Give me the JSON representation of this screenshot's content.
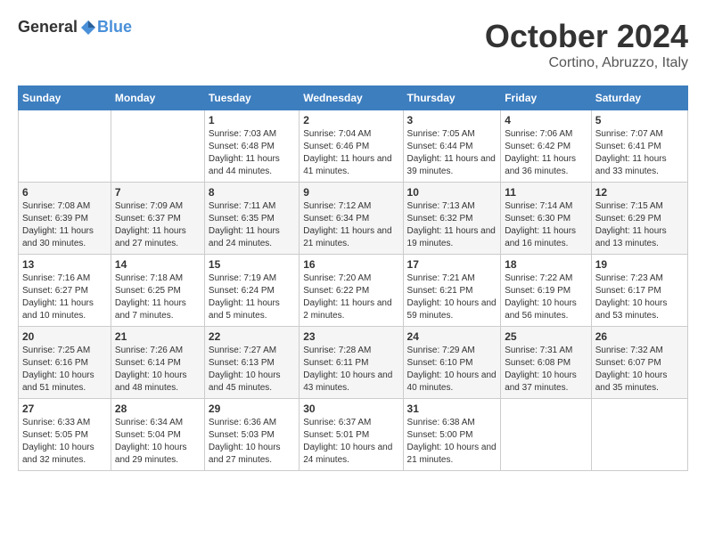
{
  "logo": {
    "general": "General",
    "blue": "Blue"
  },
  "title": "October 2024",
  "location": "Cortino, Abruzzo, Italy",
  "headers": [
    "Sunday",
    "Monday",
    "Tuesday",
    "Wednesday",
    "Thursday",
    "Friday",
    "Saturday"
  ],
  "weeks": [
    [
      {
        "day": "",
        "info": ""
      },
      {
        "day": "",
        "info": ""
      },
      {
        "day": "1",
        "info": "Sunrise: 7:03 AM\nSunset: 6:48 PM\nDaylight: 11 hours and 44 minutes."
      },
      {
        "day": "2",
        "info": "Sunrise: 7:04 AM\nSunset: 6:46 PM\nDaylight: 11 hours and 41 minutes."
      },
      {
        "day": "3",
        "info": "Sunrise: 7:05 AM\nSunset: 6:44 PM\nDaylight: 11 hours and 39 minutes."
      },
      {
        "day": "4",
        "info": "Sunrise: 7:06 AM\nSunset: 6:42 PM\nDaylight: 11 hours and 36 minutes."
      },
      {
        "day": "5",
        "info": "Sunrise: 7:07 AM\nSunset: 6:41 PM\nDaylight: 11 hours and 33 minutes."
      }
    ],
    [
      {
        "day": "6",
        "info": "Sunrise: 7:08 AM\nSunset: 6:39 PM\nDaylight: 11 hours and 30 minutes."
      },
      {
        "day": "7",
        "info": "Sunrise: 7:09 AM\nSunset: 6:37 PM\nDaylight: 11 hours and 27 minutes."
      },
      {
        "day": "8",
        "info": "Sunrise: 7:11 AM\nSunset: 6:35 PM\nDaylight: 11 hours and 24 minutes."
      },
      {
        "day": "9",
        "info": "Sunrise: 7:12 AM\nSunset: 6:34 PM\nDaylight: 11 hours and 21 minutes."
      },
      {
        "day": "10",
        "info": "Sunrise: 7:13 AM\nSunset: 6:32 PM\nDaylight: 11 hours and 19 minutes."
      },
      {
        "day": "11",
        "info": "Sunrise: 7:14 AM\nSunset: 6:30 PM\nDaylight: 11 hours and 16 minutes."
      },
      {
        "day": "12",
        "info": "Sunrise: 7:15 AM\nSunset: 6:29 PM\nDaylight: 11 hours and 13 minutes."
      }
    ],
    [
      {
        "day": "13",
        "info": "Sunrise: 7:16 AM\nSunset: 6:27 PM\nDaylight: 11 hours and 10 minutes."
      },
      {
        "day": "14",
        "info": "Sunrise: 7:18 AM\nSunset: 6:25 PM\nDaylight: 11 hours and 7 minutes."
      },
      {
        "day": "15",
        "info": "Sunrise: 7:19 AM\nSunset: 6:24 PM\nDaylight: 11 hours and 5 minutes."
      },
      {
        "day": "16",
        "info": "Sunrise: 7:20 AM\nSunset: 6:22 PM\nDaylight: 11 hours and 2 minutes."
      },
      {
        "day": "17",
        "info": "Sunrise: 7:21 AM\nSunset: 6:21 PM\nDaylight: 10 hours and 59 minutes."
      },
      {
        "day": "18",
        "info": "Sunrise: 7:22 AM\nSunset: 6:19 PM\nDaylight: 10 hours and 56 minutes."
      },
      {
        "day": "19",
        "info": "Sunrise: 7:23 AM\nSunset: 6:17 PM\nDaylight: 10 hours and 53 minutes."
      }
    ],
    [
      {
        "day": "20",
        "info": "Sunrise: 7:25 AM\nSunset: 6:16 PM\nDaylight: 10 hours and 51 minutes."
      },
      {
        "day": "21",
        "info": "Sunrise: 7:26 AM\nSunset: 6:14 PM\nDaylight: 10 hours and 48 minutes."
      },
      {
        "day": "22",
        "info": "Sunrise: 7:27 AM\nSunset: 6:13 PM\nDaylight: 10 hours and 45 minutes."
      },
      {
        "day": "23",
        "info": "Sunrise: 7:28 AM\nSunset: 6:11 PM\nDaylight: 10 hours and 43 minutes."
      },
      {
        "day": "24",
        "info": "Sunrise: 7:29 AM\nSunset: 6:10 PM\nDaylight: 10 hours and 40 minutes."
      },
      {
        "day": "25",
        "info": "Sunrise: 7:31 AM\nSunset: 6:08 PM\nDaylight: 10 hours and 37 minutes."
      },
      {
        "day": "26",
        "info": "Sunrise: 7:32 AM\nSunset: 6:07 PM\nDaylight: 10 hours and 35 minutes."
      }
    ],
    [
      {
        "day": "27",
        "info": "Sunrise: 6:33 AM\nSunset: 5:05 PM\nDaylight: 10 hours and 32 minutes."
      },
      {
        "day": "28",
        "info": "Sunrise: 6:34 AM\nSunset: 5:04 PM\nDaylight: 10 hours and 29 minutes."
      },
      {
        "day": "29",
        "info": "Sunrise: 6:36 AM\nSunset: 5:03 PM\nDaylight: 10 hours and 27 minutes."
      },
      {
        "day": "30",
        "info": "Sunrise: 6:37 AM\nSunset: 5:01 PM\nDaylight: 10 hours and 24 minutes."
      },
      {
        "day": "31",
        "info": "Sunrise: 6:38 AM\nSunset: 5:00 PM\nDaylight: 10 hours and 21 minutes."
      },
      {
        "day": "",
        "info": ""
      },
      {
        "day": "",
        "info": ""
      }
    ]
  ]
}
